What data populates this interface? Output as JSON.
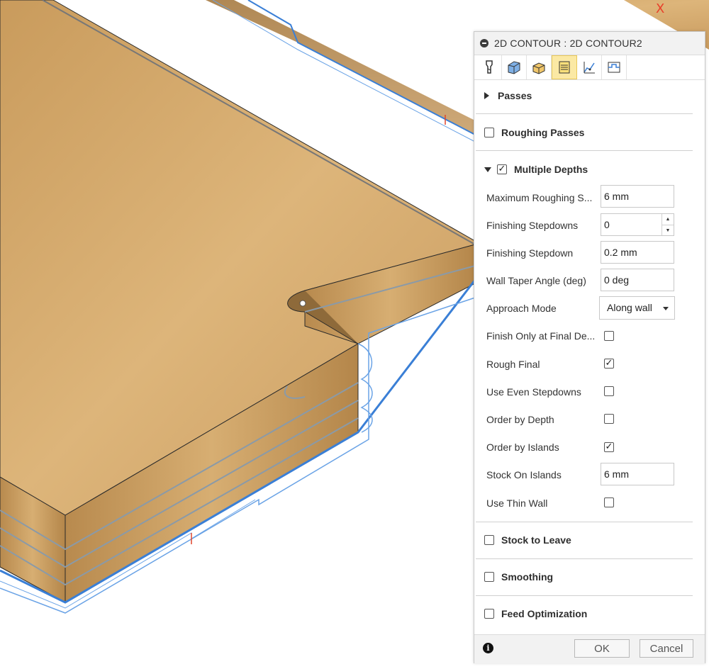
{
  "axis_label": "X",
  "panel": {
    "title": "2D CONTOUR : 2D CONTOUR2",
    "tabs": [
      {
        "name": "tool-icon"
      },
      {
        "name": "geometry-icon"
      },
      {
        "name": "heights-icon"
      },
      {
        "name": "passes-icon",
        "active": true
      },
      {
        "name": "linking-icon"
      },
      {
        "name": "post-process-icon"
      }
    ],
    "sections": {
      "passes": "Passes",
      "roughing_passes": "Roughing Passes",
      "multiple_depths": "Multiple Depths",
      "stock_to_leave": "Stock to Leave",
      "smoothing": "Smoothing",
      "feed_optimization": "Feed Optimization"
    },
    "multiple_depths_checked": true,
    "fields": {
      "max_roughing_label": "Maximum Roughing S...",
      "max_roughing_value": "6 mm",
      "finishing_stepdowns_label": "Finishing Stepdowns",
      "finishing_stepdowns_value": "0",
      "finishing_stepdown_label": "Finishing Stepdown",
      "finishing_stepdown_value": "0.2 mm",
      "wall_taper_label": "Wall Taper Angle (deg)",
      "wall_taper_value": "0 deg",
      "approach_mode_label": "Approach Mode",
      "approach_mode_value": "Along wall",
      "finish_only_label": "Finish Only at Final De...",
      "finish_only_checked": false,
      "rough_final_label": "Rough Final",
      "rough_final_checked": true,
      "use_even_label": "Use Even Stepdowns",
      "use_even_checked": false,
      "order_depth_label": "Order by Depth",
      "order_depth_checked": false,
      "order_islands_label": "Order by Islands",
      "order_islands_checked": true,
      "stock_islands_label": "Stock On Islands",
      "stock_islands_value": "6 mm",
      "thin_wall_label": "Use Thin Wall",
      "thin_wall_checked": false
    },
    "footer": {
      "ok": "OK",
      "cancel": "Cancel"
    }
  },
  "colors": {
    "wood": "#d6ac6e",
    "toolpath": "#3a7fd6",
    "accent": "#fbe9a4"
  }
}
